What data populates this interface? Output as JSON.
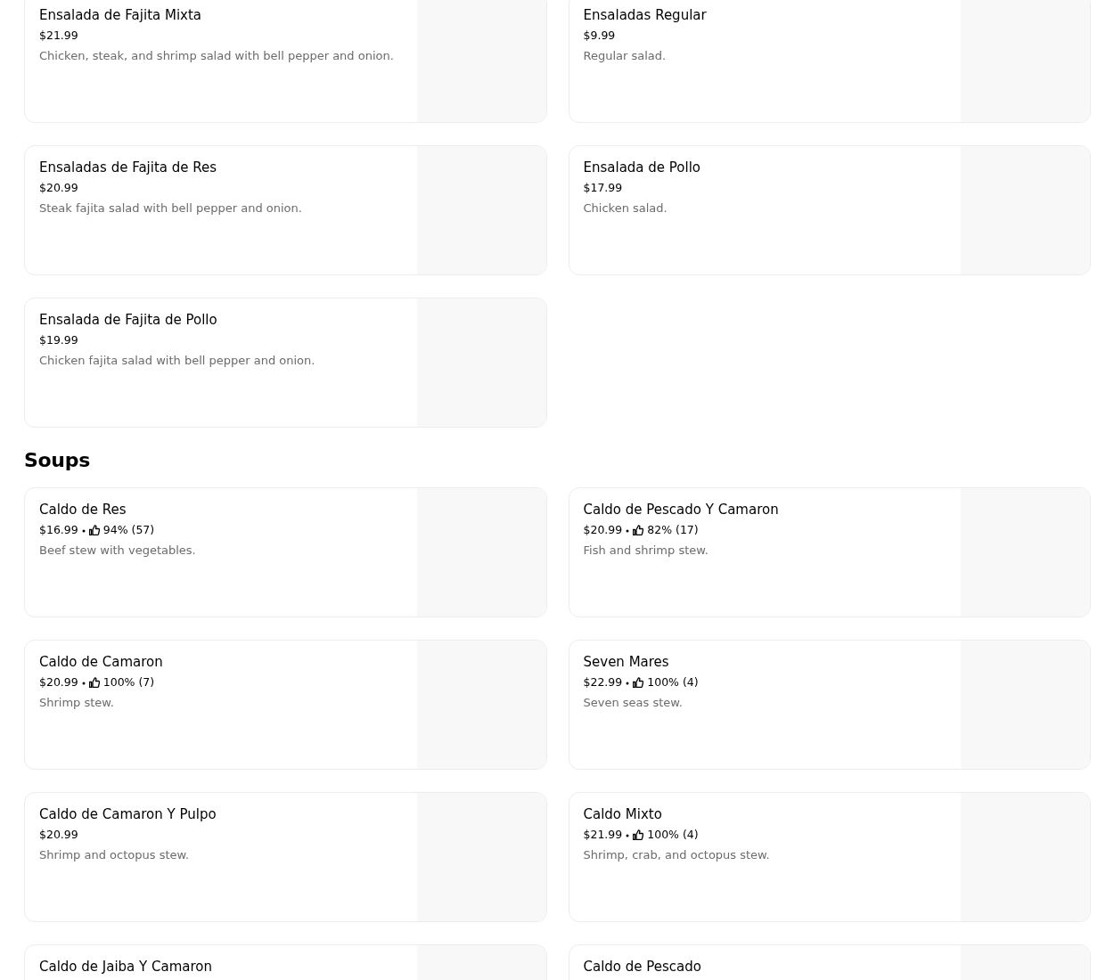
{
  "sections": [
    {
      "items": [
        {
          "name": "Ensalada de Fajita Mixta",
          "price": "$21.99",
          "description": "Chicken, steak, and shrimp salad with bell pepper and onion."
        },
        {
          "name": "Ensaladas Regular",
          "price": "$9.99",
          "description": "Regular salad."
        },
        {
          "name": "Ensaladas de Fajita de Res",
          "price": "$20.99",
          "description": "Steak fajita salad with bell pepper and onion."
        },
        {
          "name": "Ensalada de Pollo",
          "price": "$17.99",
          "description": "Chicken salad."
        },
        {
          "name": "Ensalada de Fajita de Pollo",
          "price": "$19.99",
          "description": "Chicken fajita salad with bell pepper and onion."
        }
      ]
    },
    {
      "title": "Soups",
      "items": [
        {
          "name": "Caldo de Res",
          "price": "$16.99",
          "rating": "94% (57)",
          "description": "Beef stew with vegetables."
        },
        {
          "name": "Caldo de Pescado Y Camaron",
          "price": "$20.99",
          "rating": "82% (17)",
          "description": "Fish and shrimp stew."
        },
        {
          "name": "Caldo de Camaron",
          "price": "$20.99",
          "rating": "100% (7)",
          "description": "Shrimp stew."
        },
        {
          "name": "Seven Mares",
          "price": "$22.99",
          "rating": "100% (4)",
          "description": "Seven seas stew."
        },
        {
          "name": "Caldo de Camaron Y Pulpo",
          "price": "$20.99",
          "description": "Shrimp and octopus stew."
        },
        {
          "name": "Caldo Mixto",
          "price": "$21.99",
          "rating": "100% (4)",
          "description": "Shrimp, crab, and octopus stew."
        },
        {
          "name": "Caldo de Jaiba Y Camaron"
        },
        {
          "name": "Caldo de Pescado"
        }
      ]
    }
  ]
}
